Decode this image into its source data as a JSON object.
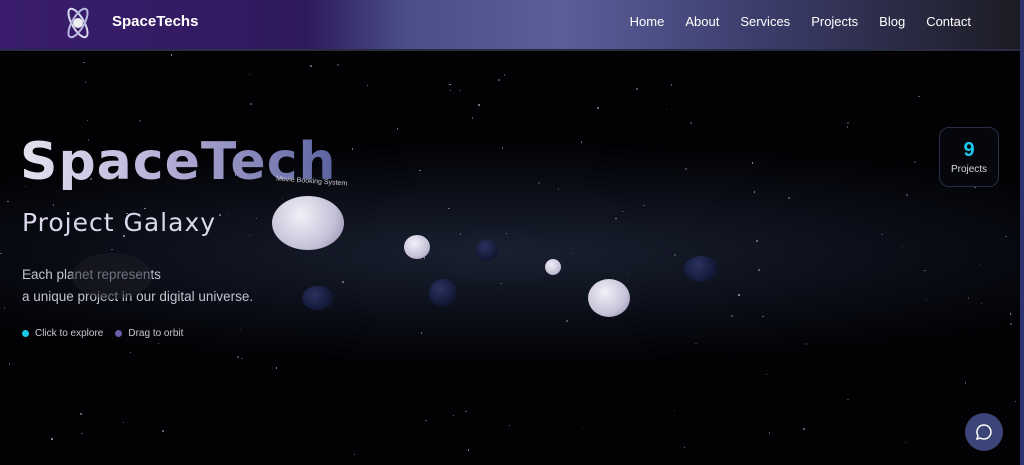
{
  "nav": {
    "brand": "SpaceTechs",
    "items": [
      "Home",
      "About",
      "Services",
      "Projects",
      "Blog",
      "Contact"
    ]
  },
  "hero": {
    "title": "SpaceTech",
    "subtitle": "Project Galaxy",
    "description_line1": "Each planet represents",
    "description_line2": "a unique project in our digital universe.",
    "hints": [
      {
        "label": "Click to explore",
        "color": "#1cc8ea"
      },
      {
        "label": "Drag to orbit",
        "color": "#6a5aa8"
      }
    ]
  },
  "planets": {
    "featured_label": "Movie Booking System"
  },
  "stats": {
    "count": "9",
    "label": "Projects"
  }
}
